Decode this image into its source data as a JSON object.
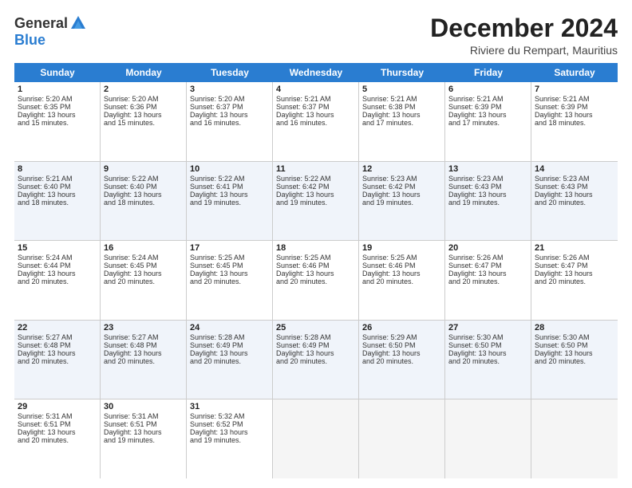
{
  "header": {
    "logo_general": "General",
    "logo_blue": "Blue",
    "month_title": "December 2024",
    "location": "Riviere du Rempart, Mauritius"
  },
  "days_of_week": [
    "Sunday",
    "Monday",
    "Tuesday",
    "Wednesday",
    "Thursday",
    "Friday",
    "Saturday"
  ],
  "weeks": [
    [
      {
        "day": "1",
        "sunrise": "5:20 AM",
        "sunset": "6:35 PM",
        "daylight": "13 hours and 15 minutes."
      },
      {
        "day": "2",
        "sunrise": "5:20 AM",
        "sunset": "6:36 PM",
        "daylight": "13 hours and 15 minutes."
      },
      {
        "day": "3",
        "sunrise": "5:20 AM",
        "sunset": "6:37 PM",
        "daylight": "13 hours and 16 minutes."
      },
      {
        "day": "4",
        "sunrise": "5:21 AM",
        "sunset": "6:37 PM",
        "daylight": "13 hours and 16 minutes."
      },
      {
        "day": "5",
        "sunrise": "5:21 AM",
        "sunset": "6:38 PM",
        "daylight": "13 hours and 17 minutes."
      },
      {
        "day": "6",
        "sunrise": "5:21 AM",
        "sunset": "6:39 PM",
        "daylight": "13 hours and 17 minutes."
      },
      {
        "day": "7",
        "sunrise": "5:21 AM",
        "sunset": "6:39 PM",
        "daylight": "13 hours and 18 minutes."
      }
    ],
    [
      {
        "day": "8",
        "sunrise": "5:21 AM",
        "sunset": "6:40 PM",
        "daylight": "13 hours and 18 minutes."
      },
      {
        "day": "9",
        "sunrise": "5:22 AM",
        "sunset": "6:40 PM",
        "daylight": "13 hours and 18 minutes."
      },
      {
        "day": "10",
        "sunrise": "5:22 AM",
        "sunset": "6:41 PM",
        "daylight": "13 hours and 19 minutes."
      },
      {
        "day": "11",
        "sunrise": "5:22 AM",
        "sunset": "6:42 PM",
        "daylight": "13 hours and 19 minutes."
      },
      {
        "day": "12",
        "sunrise": "5:23 AM",
        "sunset": "6:42 PM",
        "daylight": "13 hours and 19 minutes."
      },
      {
        "day": "13",
        "sunrise": "5:23 AM",
        "sunset": "6:43 PM",
        "daylight": "13 hours and 19 minutes."
      },
      {
        "day": "14",
        "sunrise": "5:23 AM",
        "sunset": "6:43 PM",
        "daylight": "13 hours and 20 minutes."
      }
    ],
    [
      {
        "day": "15",
        "sunrise": "5:24 AM",
        "sunset": "6:44 PM",
        "daylight": "13 hours and 20 minutes."
      },
      {
        "day": "16",
        "sunrise": "5:24 AM",
        "sunset": "6:45 PM",
        "daylight": "13 hours and 20 minutes."
      },
      {
        "day": "17",
        "sunrise": "5:25 AM",
        "sunset": "6:45 PM",
        "daylight": "13 hours and 20 minutes."
      },
      {
        "day": "18",
        "sunrise": "5:25 AM",
        "sunset": "6:46 PM",
        "daylight": "13 hours and 20 minutes."
      },
      {
        "day": "19",
        "sunrise": "5:25 AM",
        "sunset": "6:46 PM",
        "daylight": "13 hours and 20 minutes."
      },
      {
        "day": "20",
        "sunrise": "5:26 AM",
        "sunset": "6:47 PM",
        "daylight": "13 hours and 20 minutes."
      },
      {
        "day": "21",
        "sunrise": "5:26 AM",
        "sunset": "6:47 PM",
        "daylight": "13 hours and 20 minutes."
      }
    ],
    [
      {
        "day": "22",
        "sunrise": "5:27 AM",
        "sunset": "6:48 PM",
        "daylight": "13 hours and 20 minutes."
      },
      {
        "day": "23",
        "sunrise": "5:27 AM",
        "sunset": "6:48 PM",
        "daylight": "13 hours and 20 minutes."
      },
      {
        "day": "24",
        "sunrise": "5:28 AM",
        "sunset": "6:49 PM",
        "daylight": "13 hours and 20 minutes."
      },
      {
        "day": "25",
        "sunrise": "5:28 AM",
        "sunset": "6:49 PM",
        "daylight": "13 hours and 20 minutes."
      },
      {
        "day": "26",
        "sunrise": "5:29 AM",
        "sunset": "6:50 PM",
        "daylight": "13 hours and 20 minutes."
      },
      {
        "day": "27",
        "sunrise": "5:30 AM",
        "sunset": "6:50 PM",
        "daylight": "13 hours and 20 minutes."
      },
      {
        "day": "28",
        "sunrise": "5:30 AM",
        "sunset": "6:50 PM",
        "daylight": "13 hours and 20 minutes."
      }
    ],
    [
      {
        "day": "29",
        "sunrise": "5:31 AM",
        "sunset": "6:51 PM",
        "daylight": "13 hours and 20 minutes."
      },
      {
        "day": "30",
        "sunrise": "5:31 AM",
        "sunset": "6:51 PM",
        "daylight": "13 hours and 19 minutes."
      },
      {
        "day": "31",
        "sunrise": "5:32 AM",
        "sunset": "6:52 PM",
        "daylight": "13 hours and 19 minutes."
      },
      null,
      null,
      null,
      null
    ]
  ],
  "labels": {
    "sunrise_prefix": "Sunrise: ",
    "sunset_prefix": "Sunset: ",
    "daylight_prefix": "Daylight: "
  }
}
